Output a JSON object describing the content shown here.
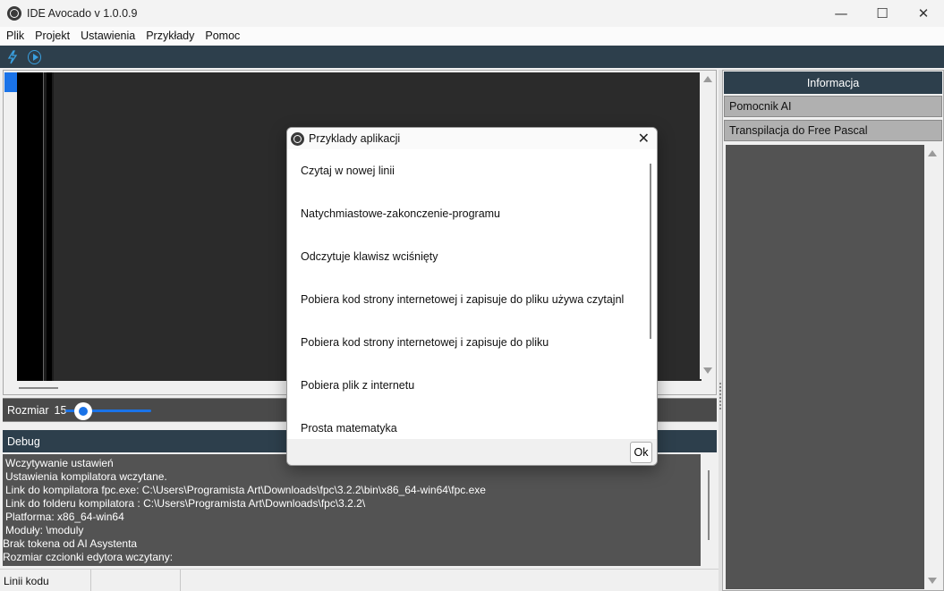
{
  "window": {
    "title": "IDE Avocado v 1.0.0.9",
    "minimize": "—",
    "maximize": "☐",
    "close": "✕"
  },
  "menu": [
    "Plik",
    "Projekt",
    "Ustawienia",
    "Przykłady",
    "Pomoc"
  ],
  "toolbar": {
    "icons": [
      "lightning-icon",
      "play-icon"
    ]
  },
  "sizebar": {
    "label": "Rozmiar",
    "value": "15",
    "slider_fraction": 0.15
  },
  "debug": {
    "title": "Debug",
    "lines": [
      "Wczytywanie ustawień",
      "Ustawienia kompilatora wczytane.",
      "Link do kompilatora fpc.exe: C:\\Users\\Programista Art\\Downloads\\fpc\\3.2.2\\bin\\x86_64-win64\\fpc.exe",
      "Link do folderu kompilatora : C:\\Users\\Programista Art\\Downloads\\fpc\\3.2.2\\",
      "Platforma: x86_64-win64",
      "Moduły: \\moduly",
      "Brak tokena od AI Asystenta",
      "Rozmiar czcionki edytora wczytany:"
    ]
  },
  "status": {
    "lines_label": "Linii kodu",
    "cell2": "",
    "cell3": ""
  },
  "right_panel": {
    "title": "Informacja",
    "buttons": [
      "Pomocnik AI",
      "Transpilacja do Free Pascal"
    ]
  },
  "dialog": {
    "title": "Przyklady aplikacji",
    "close": "✕",
    "items": [
      "Czytaj w nowej linii",
      "Natychmiastowe-zakonczenie-programu",
      "Odczytuje klawisz wciśnięty",
      "Pobiera kod strony internetowej i zapisuje do pliku używa czytajnl",
      "Pobiera kod strony internetowej i zapisuje do pliku",
      "Pobiera plik z internetu",
      "Prosta matematyka"
    ],
    "ok_label": "Ok"
  },
  "colors": {
    "toolbar_bg": "#2d3f4c",
    "accent": "#1a73e8",
    "panel_bg": "#535353"
  }
}
